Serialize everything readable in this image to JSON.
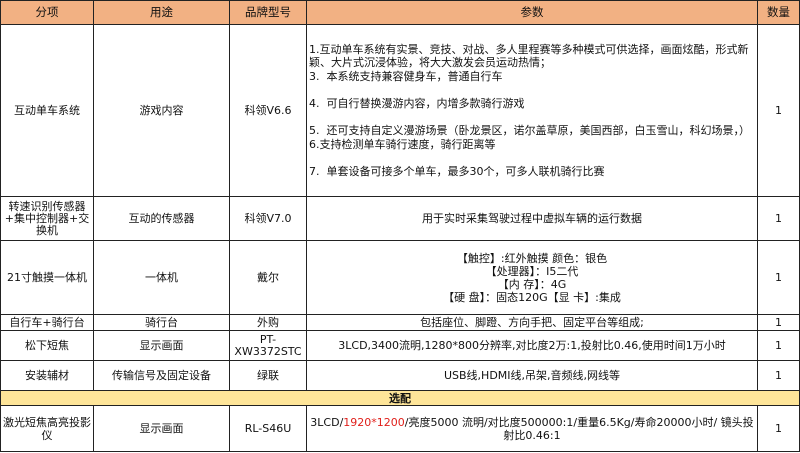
{
  "headers": [
    "分项",
    "用途",
    "品牌型号",
    "参数",
    "数量"
  ],
  "rows": [
    {
      "category": "互动单车系统",
      "usage": "游戏内容",
      "model": "科领V6.6",
      "params": [
        "1.互动单车系统有实景、竞技、对战、多人里程赛等多种模式可供选择，画面炫酷，形式新颖、大片式沉浸体验，将大大激发会员运动热情；",
        "3.  本系统支持兼容健身车，普通自行车",
        "4.  可自行替换漫游内容，内增多款骑行游戏",
        "5.  还可支持自定义漫游场景（卧龙景区，诺尔盖草原，美国西部，白玉雪山，科幻场景，）",
        "6.支持检测单车骑行速度，骑行距离等",
        "7.  单套设备可接多个单车，最多30个，可多人联机骑行比赛"
      ],
      "qty": "1"
    },
    {
      "category": "转速识别传感器+集中控制器+交换机",
      "usage": "互动的传感器",
      "model": "科领V7.0",
      "params": [
        "用于实时采集驾驶过程中虚拟车辆的运行数据"
      ],
      "qty": "1"
    },
    {
      "category": "21寸触摸一体机",
      "usage": "一体机",
      "model": "戴尔",
      "params": [
        "【触控】:红外触摸 颜色：银色",
        "【处理器】：I5二代",
        "【内 存】：4G",
        "【硬 盘】：固态120G【显 卡】:集成"
      ],
      "qty": "1"
    },
    {
      "category": "自行车+骑行台",
      "usage": "骑行台",
      "model": "外购",
      "params": [
        "包括座位、脚蹬、方向手把、固定平台等组成;"
      ],
      "qty": "1"
    },
    {
      "category": "松下短焦",
      "usage": "显示画面",
      "model": "PT-XW3372STC",
      "params": [
        "3LCD,3400流明,1280*800分辨率,对比度2万:1,投射比0.46,使用时间1万小时"
      ],
      "qty": "1"
    },
    {
      "category": "安装辅材",
      "usage": "传输信号及固定设备",
      "model": "绿联",
      "params": [
        "USB线,HDMI线,吊架,音频线,网线等"
      ],
      "qty": "1"
    }
  ],
  "section_label": "选配",
  "optional_row": {
    "category": "激光短焦高亮投影仪",
    "usage": "显示画面",
    "model": "RL-S46U",
    "param_pre": "3LCD/",
    "param_red": "1920*1200",
    "param_post": "/亮度5000 流明/对比度500000:1/重量6.5Kg/寿命20000小时/ 镜头投射比0.46:1",
    "qty": "1"
  },
  "colors": {
    "header_bg": "#f2b183",
    "section_bg": "#fee599",
    "highlight_text": "#e0201b"
  }
}
